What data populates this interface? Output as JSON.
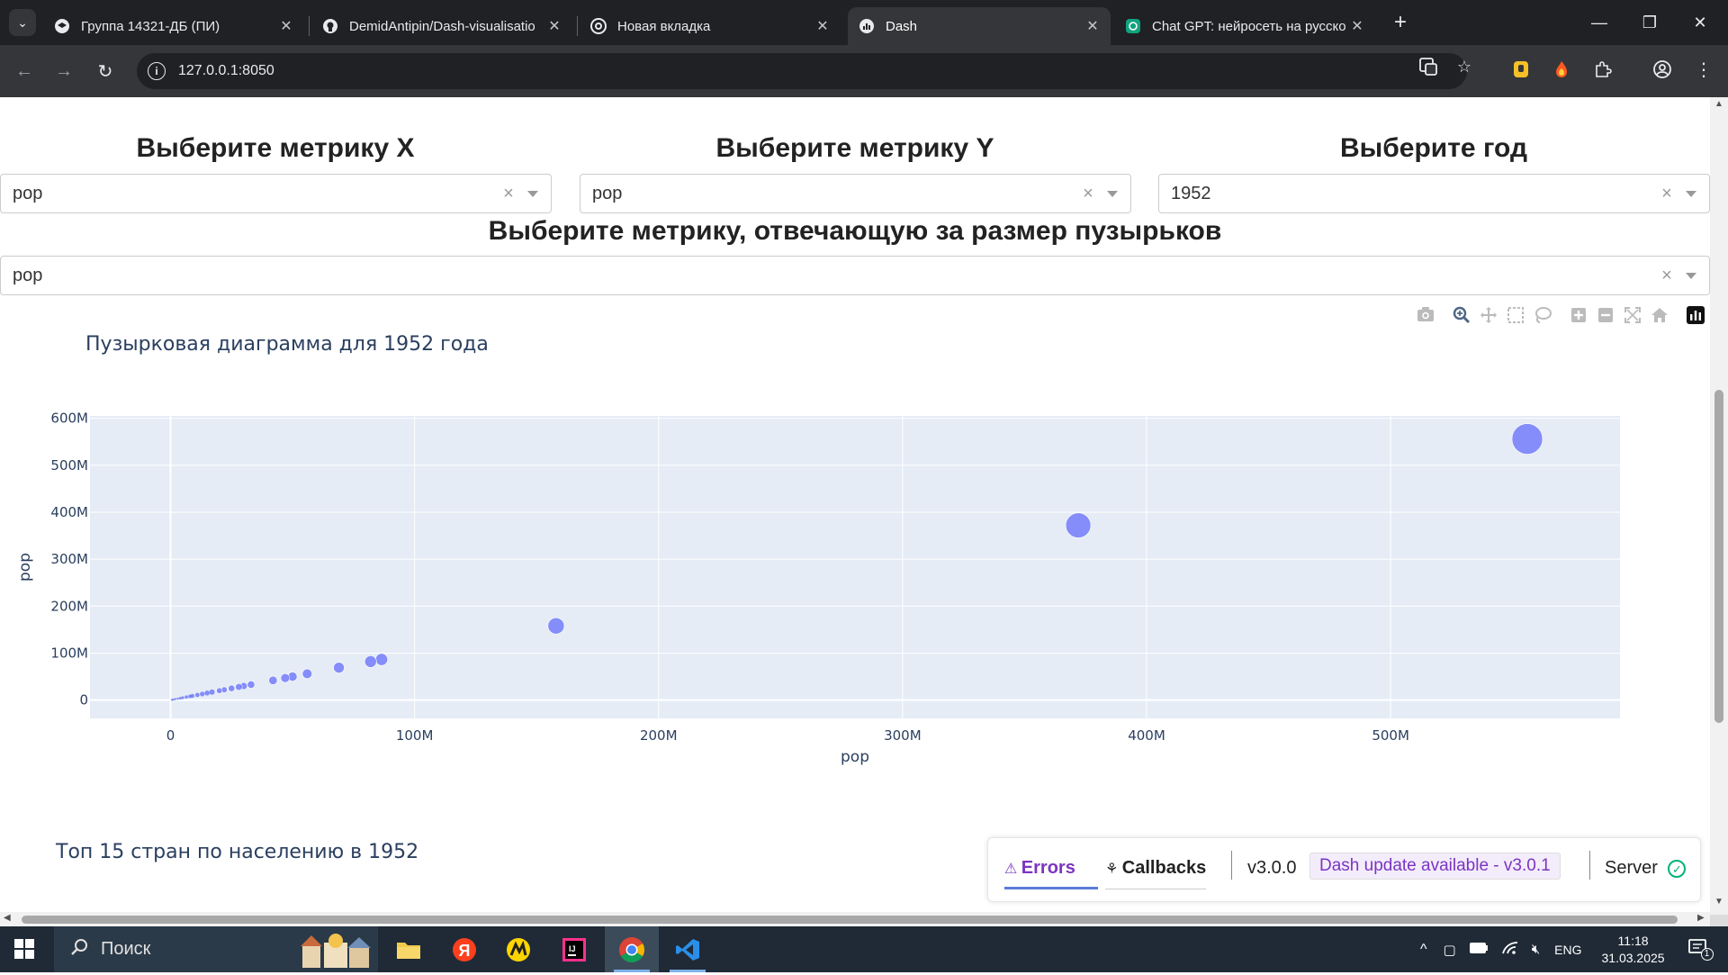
{
  "browser": {
    "tabs": [
      {
        "title": "Группа 14321-ДБ (ПИ)",
        "icon": "graduation-cap-icon"
      },
      {
        "title": "DemidAntipin/Dash-visualisatio",
        "icon": "github-icon"
      },
      {
        "title": "Новая вкладка",
        "icon": "chrome-icon"
      },
      {
        "title": "Dash",
        "icon": "dash-icon",
        "active": true
      },
      {
        "title": "Chat GPT: нейросеть на русско",
        "icon": "chatgpt-icon"
      }
    ],
    "url": "127.0.0.1:8050"
  },
  "controls": {
    "x_label": "Выберите метрику X",
    "y_label": "Выберите метрику Y",
    "year_label": "Выберите год",
    "size_label": "Выберите метрику, отвечающую за размер пузырьков",
    "x_value": "pop",
    "y_value": "pop",
    "year_value": "1952",
    "size_value": "pop"
  },
  "chart_data": {
    "type": "scatter",
    "title": "Пузырковая диаграмма для 1952 года",
    "xlabel": "pop",
    "ylabel": "pop",
    "xlim": [
      -33000000,
      594000000
    ],
    "ylim": [
      -39000000,
      605000000
    ],
    "x_ticks": [
      0,
      100000000,
      200000000,
      300000000,
      400000000,
      500000000
    ],
    "x_tick_labels": [
      "0",
      "100M",
      "200M",
      "300M",
      "400M",
      "500M"
    ],
    "y_ticks": [
      0,
      100000000,
      200000000,
      300000000,
      400000000,
      500000000,
      600000000
    ],
    "y_tick_labels": [
      "0",
      "100M",
      "200M",
      "300M",
      "400M",
      "500M",
      "600M"
    ],
    "bubble_color": "#636efa",
    "points": [
      {
        "x": 556000000,
        "y": 556000000
      },
      {
        "x": 372000000,
        "y": 372000000
      },
      {
        "x": 158000000,
        "y": 158000000
      },
      {
        "x": 86500000,
        "y": 86500000
      },
      {
        "x": 82000000,
        "y": 82000000
      },
      {
        "x": 69000000,
        "y": 69000000
      },
      {
        "x": 56000000,
        "y": 56000000
      },
      {
        "x": 50000000,
        "y": 50000000
      },
      {
        "x": 47000000,
        "y": 47000000
      },
      {
        "x": 42000000,
        "y": 42000000
      },
      {
        "x": 33000000,
        "y": 33000000
      },
      {
        "x": 30000000,
        "y": 30000000
      },
      {
        "x": 28000000,
        "y": 28000000
      },
      {
        "x": 25000000,
        "y": 25000000
      },
      {
        "x": 22000000,
        "y": 22000000
      },
      {
        "x": 20000000,
        "y": 20000000
      },
      {
        "x": 17000000,
        "y": 17000000
      },
      {
        "x": 15000000,
        "y": 15000000
      },
      {
        "x": 13000000,
        "y": 13000000
      },
      {
        "x": 11000000,
        "y": 11000000
      },
      {
        "x": 9000000,
        "y": 9000000
      },
      {
        "x": 8000000,
        "y": 8000000
      },
      {
        "x": 6500000,
        "y": 6500000
      },
      {
        "x": 5000000,
        "y": 5000000
      },
      {
        "x": 4000000,
        "y": 4000000
      },
      {
        "x": 3000000,
        "y": 3000000
      },
      {
        "x": 2000000,
        "y": 2000000
      },
      {
        "x": 1200000,
        "y": 1200000
      },
      {
        "x": 600000,
        "y": 600000
      }
    ]
  },
  "top15_title": "Топ 15 стран по населению в 1952",
  "debug": {
    "errors": "Errors",
    "callbacks": "Callbacks",
    "version": "v3.0.0",
    "update": "Dash update available - v3.0.1",
    "server": "Server"
  },
  "taskbar": {
    "search": "Поиск",
    "lang": "ENG",
    "time": "11:18",
    "date": "31.03.2025",
    "notifications": "1"
  }
}
